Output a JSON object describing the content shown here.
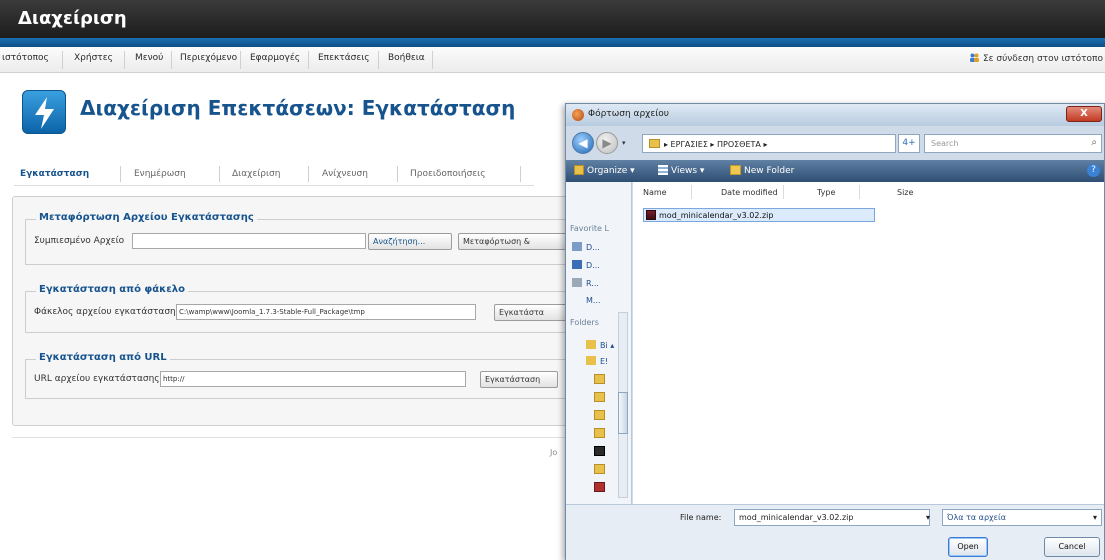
{
  "app": {
    "title": "Διαχείριση"
  },
  "menu": {
    "items": [
      "ιστότοπος",
      "Χρήστες",
      "Μενού",
      "Περιεχόμενο",
      "Εφαρμογές",
      "Επεκτάσεις",
      "Βοήθεια"
    ],
    "online_text": "Σε σύνδεση στον ιστότοπο"
  },
  "page": {
    "title": "Διαχείριση Επεκτάσεων: Εγκατάσταση"
  },
  "tabs": [
    "Εγκατάσταση",
    "Ενημέρωση",
    "Διαχείριση",
    "Ανίχνευση",
    "Προειδοποιήσεις"
  ],
  "sections": {
    "upload": {
      "legend": "Μεταφόρτωση Αρχείου Εγκατάστασης",
      "label": "Συμπιεσμένο Αρχείο",
      "browse_button": "Αναζήτηση...",
      "submit_button": "Μεταφόρτωση &"
    },
    "folder": {
      "legend": "Εγκατάσταση από φάκελο",
      "label": "Φάκελος αρχείου εγκατάστασης",
      "value": "C:\\wamp\\www\\Joomla_1.7.3-Stable-Full_Package\\tmp",
      "submit_button": "Εγκατάστα"
    },
    "url": {
      "legend": "Εγκατάσταση από URL",
      "label": "URL αρχείου εγκατάστασης",
      "value": "http://",
      "submit_button": "Εγκατάσταση"
    }
  },
  "footer": {
    "text": "Jo"
  },
  "dialog": {
    "title": "Φόρτωση αρχείου",
    "close": "X",
    "back": "◀",
    "forward": "▶",
    "address": "▸ ΕΡΓΑΣΙΕΣ ▸ ΠΡΟΣΘΕΤΑ ▸",
    "refresh": "4+",
    "search_placeholder": "Search",
    "toolbar": {
      "organize": "Organize ▾",
      "views": "Views ▾",
      "new_folder": "New Folder",
      "help": "?"
    },
    "left_pane": {
      "favorites_header": "Favorite L",
      "favorites": [
        "D...",
        "D...",
        "R...",
        "M..."
      ],
      "folders_header": "Folders",
      "folders": [
        "Bi ▴",
        "E!"
      ]
    },
    "columns": [
      "Name",
      "Date modified",
      "Type",
      "Size"
    ],
    "files": [
      "mod_minicalendar_v3.02.zip"
    ],
    "filename_label": "File name:",
    "filename_value": "mod_minicalendar_v3.02.zip",
    "filetype_value": "Όλα τα αρχεία",
    "open_button": "Open",
    "cancel_button": "Cancel"
  }
}
